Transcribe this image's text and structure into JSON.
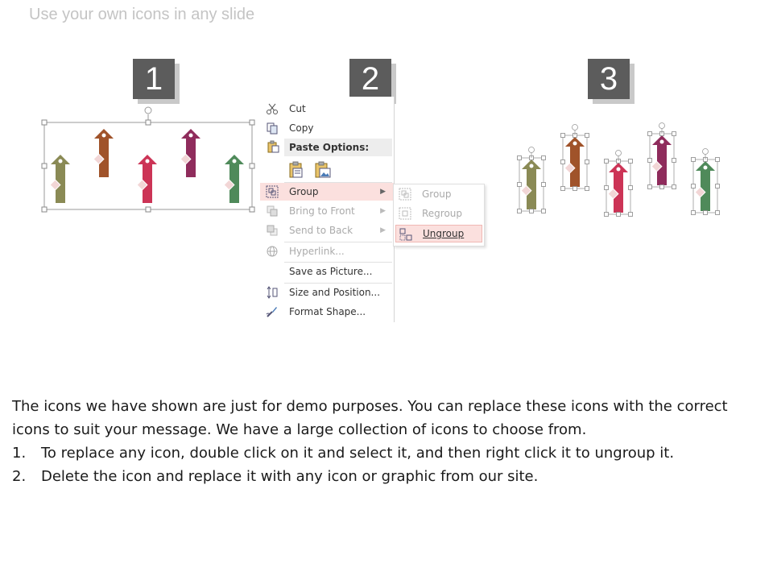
{
  "title": "Use your own icons in any slide",
  "steps": [
    "1",
    "2",
    "3"
  ],
  "colors": {
    "olive": "#8a8a55",
    "brown": "#a0532a",
    "crimson": "#cc3456",
    "purple": "#8f2c5c",
    "green": "#4f8a5a",
    "menu_highlight": "#fbe0de",
    "step_box": "#5c5c5c"
  },
  "arrow_icons": [
    "check-icon",
    "pencil-icon",
    "tag-icon",
    "rocket-icon",
    "gift-icon"
  ],
  "context_menu": {
    "cut": "Cut",
    "copy": "Copy",
    "paste_options": "Paste Options:",
    "group": "Group",
    "bring_to_front": "Bring to Front",
    "send_to_back": "Send to Back",
    "hyperlink": "Hyperlink...",
    "save_as_picture": "Save as Picture...",
    "size_and_position": "Size and Position...",
    "format_shape": "Format Shape..."
  },
  "submenu": {
    "group": "Group",
    "regroup": "Regroup",
    "ungroup": "Ungroup"
  },
  "description": {
    "intro": "The icons we have shown are just for demo purposes. You can replace these icons with the correct icons to suit your message. We have a large collection of icons to choose from.",
    "items": [
      {
        "num": "1.",
        "text": "To replace any icon, double click on it and select it, and then right click it to ungroup it."
      },
      {
        "num": "2.",
        "text": "Delete the icon and replace it with any icon or graphic from our site."
      }
    ]
  }
}
